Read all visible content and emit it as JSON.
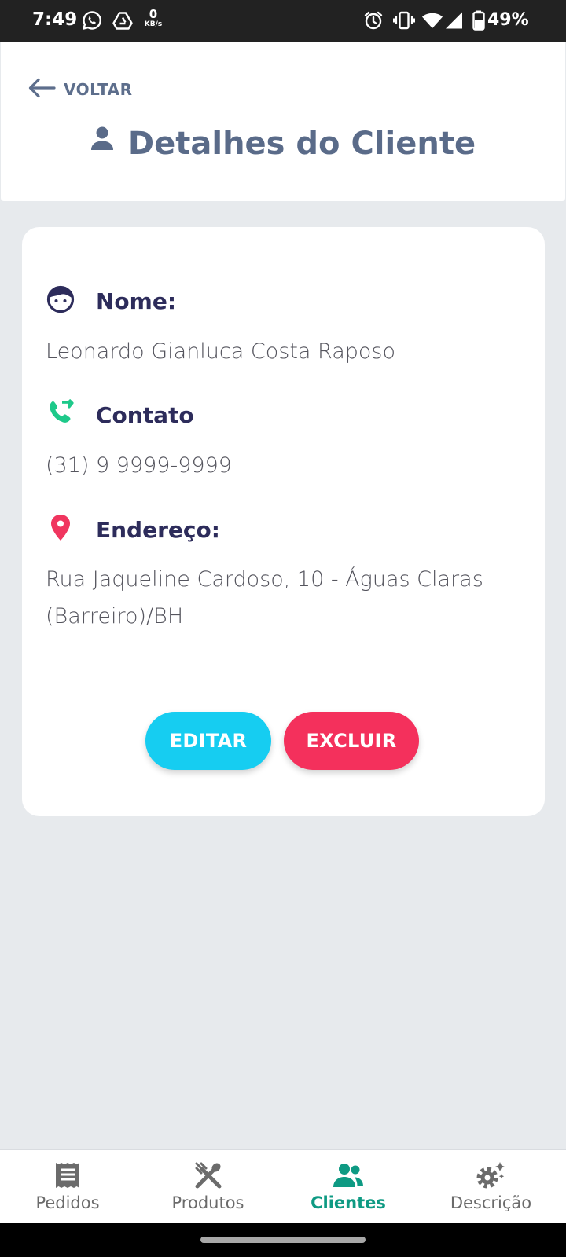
{
  "status_bar": {
    "time": "7:49",
    "net_speed_value": "0",
    "net_speed_unit": "KB/s",
    "battery": "49%",
    "icons": [
      "whatsapp-icon",
      "drive-icon",
      "alarm-icon",
      "vibrate-icon",
      "wifi-icon",
      "signal-icon",
      "battery-icon"
    ]
  },
  "header": {
    "back_label": "VOLTAR",
    "title": "Detalhes do Cliente"
  },
  "client": {
    "name_label": "Nome:",
    "name": "Leonardo Gianluca Costa Raposo",
    "contact_label": "Contato",
    "contact": "(31) 9 9999-9999",
    "address_label": "Endereço:",
    "address": "Rua Jaqueline Cardoso, 10 - Águas Claras (Barreiro)/BH"
  },
  "actions": {
    "edit_label": "EDITAR",
    "delete_label": "EXCLUIR"
  },
  "bottom_nav": {
    "items": [
      {
        "label": "Pedidos",
        "icon": "receipt-icon",
        "active": false
      },
      {
        "label": "Produtos",
        "icon": "utensils-icon",
        "active": false
      },
      {
        "label": "Clientes",
        "icon": "users-icon",
        "active": true
      },
      {
        "label": "Descrição",
        "icon": "gear-sparkle-icon",
        "active": false
      }
    ]
  },
  "colors": {
    "title_slate": "#5a6b89",
    "label_navy": "#2d2c5b",
    "contact_green": "#1ec98a",
    "location_red": "#f0355f",
    "edit_button": "#16cdf1",
    "delete_button": "#f4305c",
    "nav_active": "#0e9a83",
    "background": "#e7eaed"
  }
}
